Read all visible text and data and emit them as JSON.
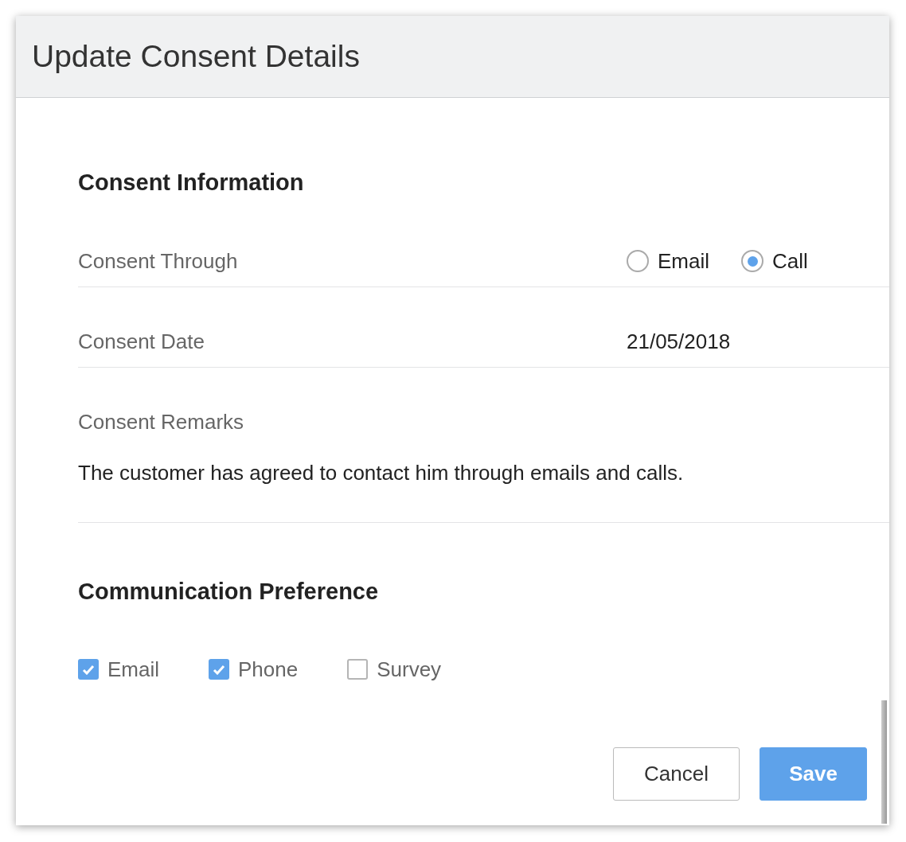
{
  "dialog": {
    "title": "Update Consent Details"
  },
  "consent_information": {
    "heading": "Consent Information",
    "consent_through": {
      "label": "Consent Through",
      "options": [
        {
          "label": "Email",
          "selected": false
        },
        {
          "label": "Call",
          "selected": true
        }
      ]
    },
    "consent_date": {
      "label": "Consent Date",
      "value": "21/05/2018"
    },
    "consent_remarks": {
      "label": "Consent Remarks",
      "value": "The customer has agreed to contact him through emails and calls."
    }
  },
  "communication_preference": {
    "heading": "Communication Preference",
    "options": [
      {
        "label": "Email",
        "checked": true
      },
      {
        "label": "Phone",
        "checked": true
      },
      {
        "label": "Survey",
        "checked": false
      }
    ]
  },
  "buttons": [
    {
      "label": "Cancel",
      "kind": "secondary"
    },
    {
      "label": "Save",
      "kind": "primary"
    }
  ]
}
